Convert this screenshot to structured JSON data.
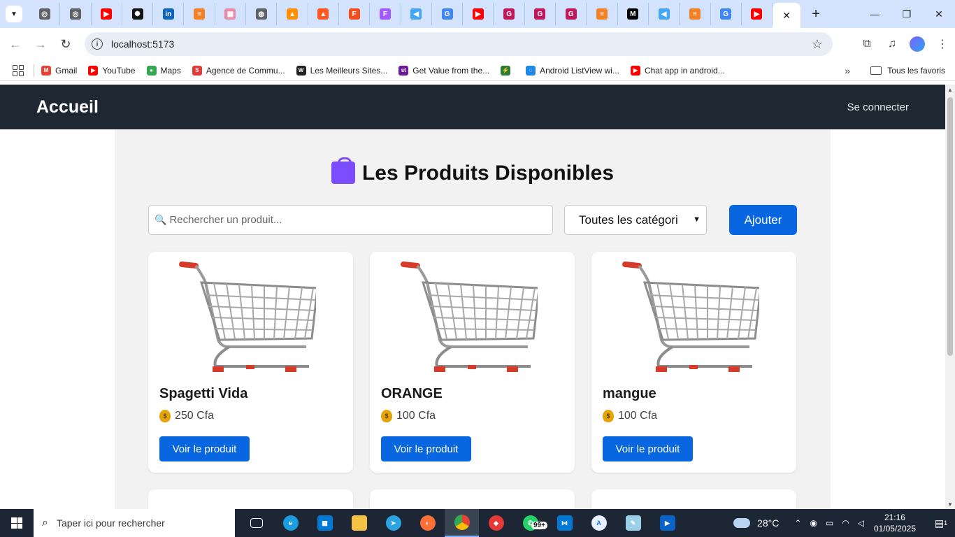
{
  "browser": {
    "tabs": [
      {
        "icon": "chrome-icon",
        "color": "#5f6368",
        "glyph": "◎"
      },
      {
        "icon": "chrome-icon",
        "color": "#5f6368",
        "glyph": "◎"
      },
      {
        "icon": "youtube-icon",
        "color": "#ff0000",
        "glyph": "▶"
      },
      {
        "icon": "openai-icon",
        "color": "#111111",
        "glyph": "✺"
      },
      {
        "icon": "linkedin-icon",
        "color": "#0a66c2",
        "glyph": "in"
      },
      {
        "icon": "stackoverflow-icon",
        "color": "#f48024",
        "glyph": "≡"
      },
      {
        "icon": "grid-app-icon",
        "color": "#e98ba8",
        "glyph": "▦"
      },
      {
        "icon": "globe-icon",
        "color": "#5f6368",
        "glyph": "◍"
      },
      {
        "icon": "firebase-icon",
        "color": "#ff8f00",
        "glyph": "▲"
      },
      {
        "icon": "firebase-icon",
        "color": "#ff5722",
        "glyph": "▲"
      },
      {
        "icon": "figma-icon",
        "color": "#f24e1e",
        "glyph": "F"
      },
      {
        "icon": "figma-icon",
        "color": "#a259ff",
        "glyph": "F"
      },
      {
        "icon": "flutter-icon",
        "color": "#42a5f5",
        "glyph": "◀"
      },
      {
        "icon": "google-icon",
        "color": "#4285f4",
        "glyph": "G"
      },
      {
        "icon": "youtube-icon",
        "color": "#ff0000",
        "glyph": "▶"
      },
      {
        "icon": "gemini-g-icon",
        "color": "#c2185b",
        "glyph": "G"
      },
      {
        "icon": "gemini-g-icon",
        "color": "#c2185b",
        "glyph": "G"
      },
      {
        "icon": "gemini-g-icon",
        "color": "#c2185b",
        "glyph": "G"
      },
      {
        "icon": "stackoverflow-icon",
        "color": "#f48024",
        "glyph": "≡"
      },
      {
        "icon": "medium-icon",
        "color": "#000000",
        "glyph": "M"
      },
      {
        "icon": "flutter-icon",
        "color": "#42a5f5",
        "glyph": "◀"
      },
      {
        "icon": "stackoverflow-icon",
        "color": "#f48024",
        "glyph": "≡"
      },
      {
        "icon": "google-icon",
        "color": "#4285f4",
        "glyph": "G"
      },
      {
        "icon": "youtube-icon",
        "color": "#ff0000",
        "glyph": "▶"
      }
    ],
    "url": "localhost:5173",
    "bookmarks": [
      {
        "label": "Gmail",
        "color": "#ea4335",
        "glyph": "M"
      },
      {
        "label": "YouTube",
        "color": "#ff0000",
        "glyph": "▶"
      },
      {
        "label": "Maps",
        "color": "#34a853",
        "glyph": "●"
      },
      {
        "label": "Agence de Commu...",
        "color": "#e53935",
        "glyph": "S"
      },
      {
        "label": "Les Meilleurs Sites...",
        "color": "#222222",
        "glyph": "W"
      },
      {
        "label": "Get Value from the...",
        "color": "#6a1b9a",
        "glyph": "st"
      },
      {
        "label": "",
        "color": "#2e7d32",
        "glyph": "⚡"
      },
      {
        "label": "Android ListView wi...",
        "color": "#1e88e5",
        "glyph": "◌"
      },
      {
        "label": "Chat app in android...",
        "color": "#ff0000",
        "glyph": "▶"
      }
    ],
    "all_bookmarks": "Tous les favoris"
  },
  "app": {
    "brand": "Accueil",
    "login": "Se connecter",
    "heading": "Les Produits Disponibles",
    "search_placeholder": "Rechercher un produit...",
    "category_selected": "Toutes les catégori",
    "add_button": "Ajouter",
    "products": [
      {
        "name": "Spagetti Vida",
        "price": "250 Cfa",
        "button": "Voir le produit"
      },
      {
        "name": "ORANGE",
        "price": "100 Cfa",
        "button": "Voir le produit"
      },
      {
        "name": "mangue",
        "price": "100 Cfa",
        "button": "Voir le produit"
      }
    ],
    "accent_color": "#0766e0",
    "nav_color": "#1e2833"
  },
  "taskbar": {
    "search_placeholder": "Taper ici pour rechercher",
    "whatsapp_badge": "99+",
    "temperature": "28°C",
    "time": "21:16",
    "date": "01/05/2025",
    "notifications": "1"
  }
}
